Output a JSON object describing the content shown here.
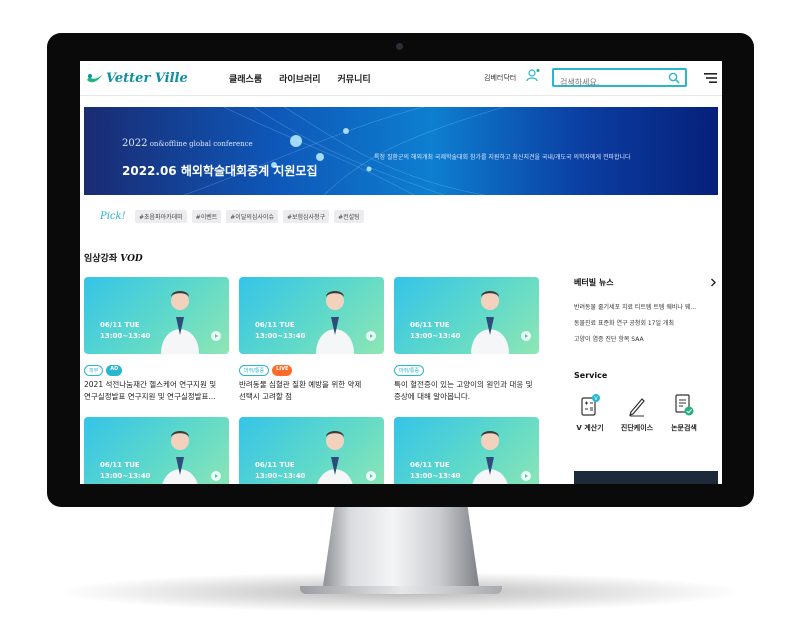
{
  "header": {
    "logo_text": "Vetter Ville",
    "nav": [
      "클래스룸",
      "라이브러리",
      "커뮤니티"
    ],
    "user_name": "김베터닥터",
    "search_placeholder": "검색하세요."
  },
  "banner": {
    "year": "2022",
    "subtitle": "on&offline global conference",
    "title": "2022.06 해외학술대회중계 지원모집",
    "description": "특정 질환군의 해외개최 국제학술대회 참가를 지원하고 최신지견을  국내/개도국 의학자에게 전파합니다"
  },
  "pick": {
    "label": "Pick!",
    "tags": [
      "#초음파아카데미",
      "#이벤트",
      "#이달의심사이슈",
      "#보험심사청구",
      "#컨설팅"
    ]
  },
  "vod": {
    "title_prefix": "임상강좌",
    "title_suffix": "VOD",
    "cards": [
      {
        "date": "06/11 TUE",
        "time": "13:00~13:40",
        "badges": [
          {
            "text": "피부",
            "style": "out"
          },
          {
            "text": "AD",
            "style": "ad"
          }
        ],
        "line1": "2021 석전나눔재간 헬스케어 연구지원 및",
        "line2": "연구실정발표 연구지원 및 연구실정발표..."
      },
      {
        "date": "06/11 TUE",
        "time": "13:00~13:40",
        "badges": [
          {
            "text": "마취/통증",
            "style": "out"
          },
          {
            "text": "LIVE",
            "style": "live"
          }
        ],
        "line1": "반려동물 심혈관 질환 예방을 위한 약제",
        "line2": "선택시 고려할 점"
      },
      {
        "date": "06/11 TUE",
        "time": "13:00~13:40",
        "badges": [
          {
            "text": "마취/통증",
            "style": "out"
          }
        ],
        "line1": "특이 혈전증이 있는 고양이의 원인과 대응 및",
        "line2": "증상에 대해 알아봅니다."
      },
      {
        "date": "06/11 TUE",
        "time": "13:00~13:40"
      },
      {
        "date": "06/11 TUE",
        "time": "13:00~13:40"
      },
      {
        "date": "06/11 TUE",
        "time": "13:00~13:40"
      }
    ]
  },
  "news": {
    "title": "베터빌 뉴스",
    "items": [
      "반려동물 줄기세포 치료 티트템 트템 웨비나 웨...",
      "동물진료 표준화 연구 공청회 17일 개최",
      "고양이 염증 진단 항목 SAA"
    ]
  },
  "service": {
    "title": "Service",
    "items": [
      {
        "label": "V 계산기",
        "icon": "calculator-icon"
      },
      {
        "label": "진단케이스",
        "icon": "pen-icon"
      },
      {
        "label": "논문검색",
        "icon": "document-check-icon"
      }
    ]
  },
  "colors": {
    "accent": "#29b6d0",
    "live": "#ff6a2b",
    "banner": "#0e57b8"
  }
}
